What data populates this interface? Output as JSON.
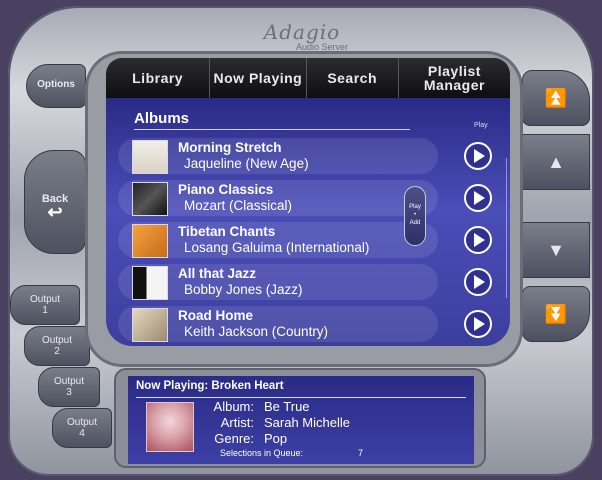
{
  "brand": {
    "name": "Adagio",
    "subtitle": "Audio Server"
  },
  "left_buttons": {
    "options": "Options",
    "back": "Back",
    "outputs": [
      {
        "label": "Output",
        "num": "1"
      },
      {
        "label": "Output",
        "num": "2"
      },
      {
        "label": "Output",
        "num": "3"
      },
      {
        "label": "Output",
        "num": "4"
      }
    ]
  },
  "tabs": [
    {
      "label": "Library"
    },
    {
      "label": "Now Playing"
    },
    {
      "label": "Search"
    },
    {
      "label": "Playlist Manager"
    }
  ],
  "list": {
    "section_title": "Albums",
    "play_header": "Play",
    "play_add_top": "Play",
    "play_add_bottom": "Add",
    "items": [
      {
        "title": "Morning Stretch",
        "subtitle": "Jaqueline (New Age)"
      },
      {
        "title": "Piano Classics",
        "subtitle": "Mozart (Classical)"
      },
      {
        "title": "Tibetan Chants",
        "subtitle": "Losang Galuima (International)"
      },
      {
        "title": "All that Jazz",
        "subtitle": "Bobby Jones (Jazz)"
      },
      {
        "title": "Road Home",
        "subtitle": "Keith Jackson (Country)"
      }
    ]
  },
  "now_playing": {
    "title": "Now Playing: Broken Heart",
    "album_label": "Album:",
    "album": "Be True",
    "artist_label": "Artist:",
    "artist": "Sarah Michelle",
    "genre_label": "Genre:",
    "genre": "Pop",
    "queue_label": "Selections in Queue:",
    "queue_count": "7"
  },
  "colors": {
    "screen": "#3b3da3",
    "frame": "#a6a9b3",
    "tab_bar": "#111114"
  }
}
